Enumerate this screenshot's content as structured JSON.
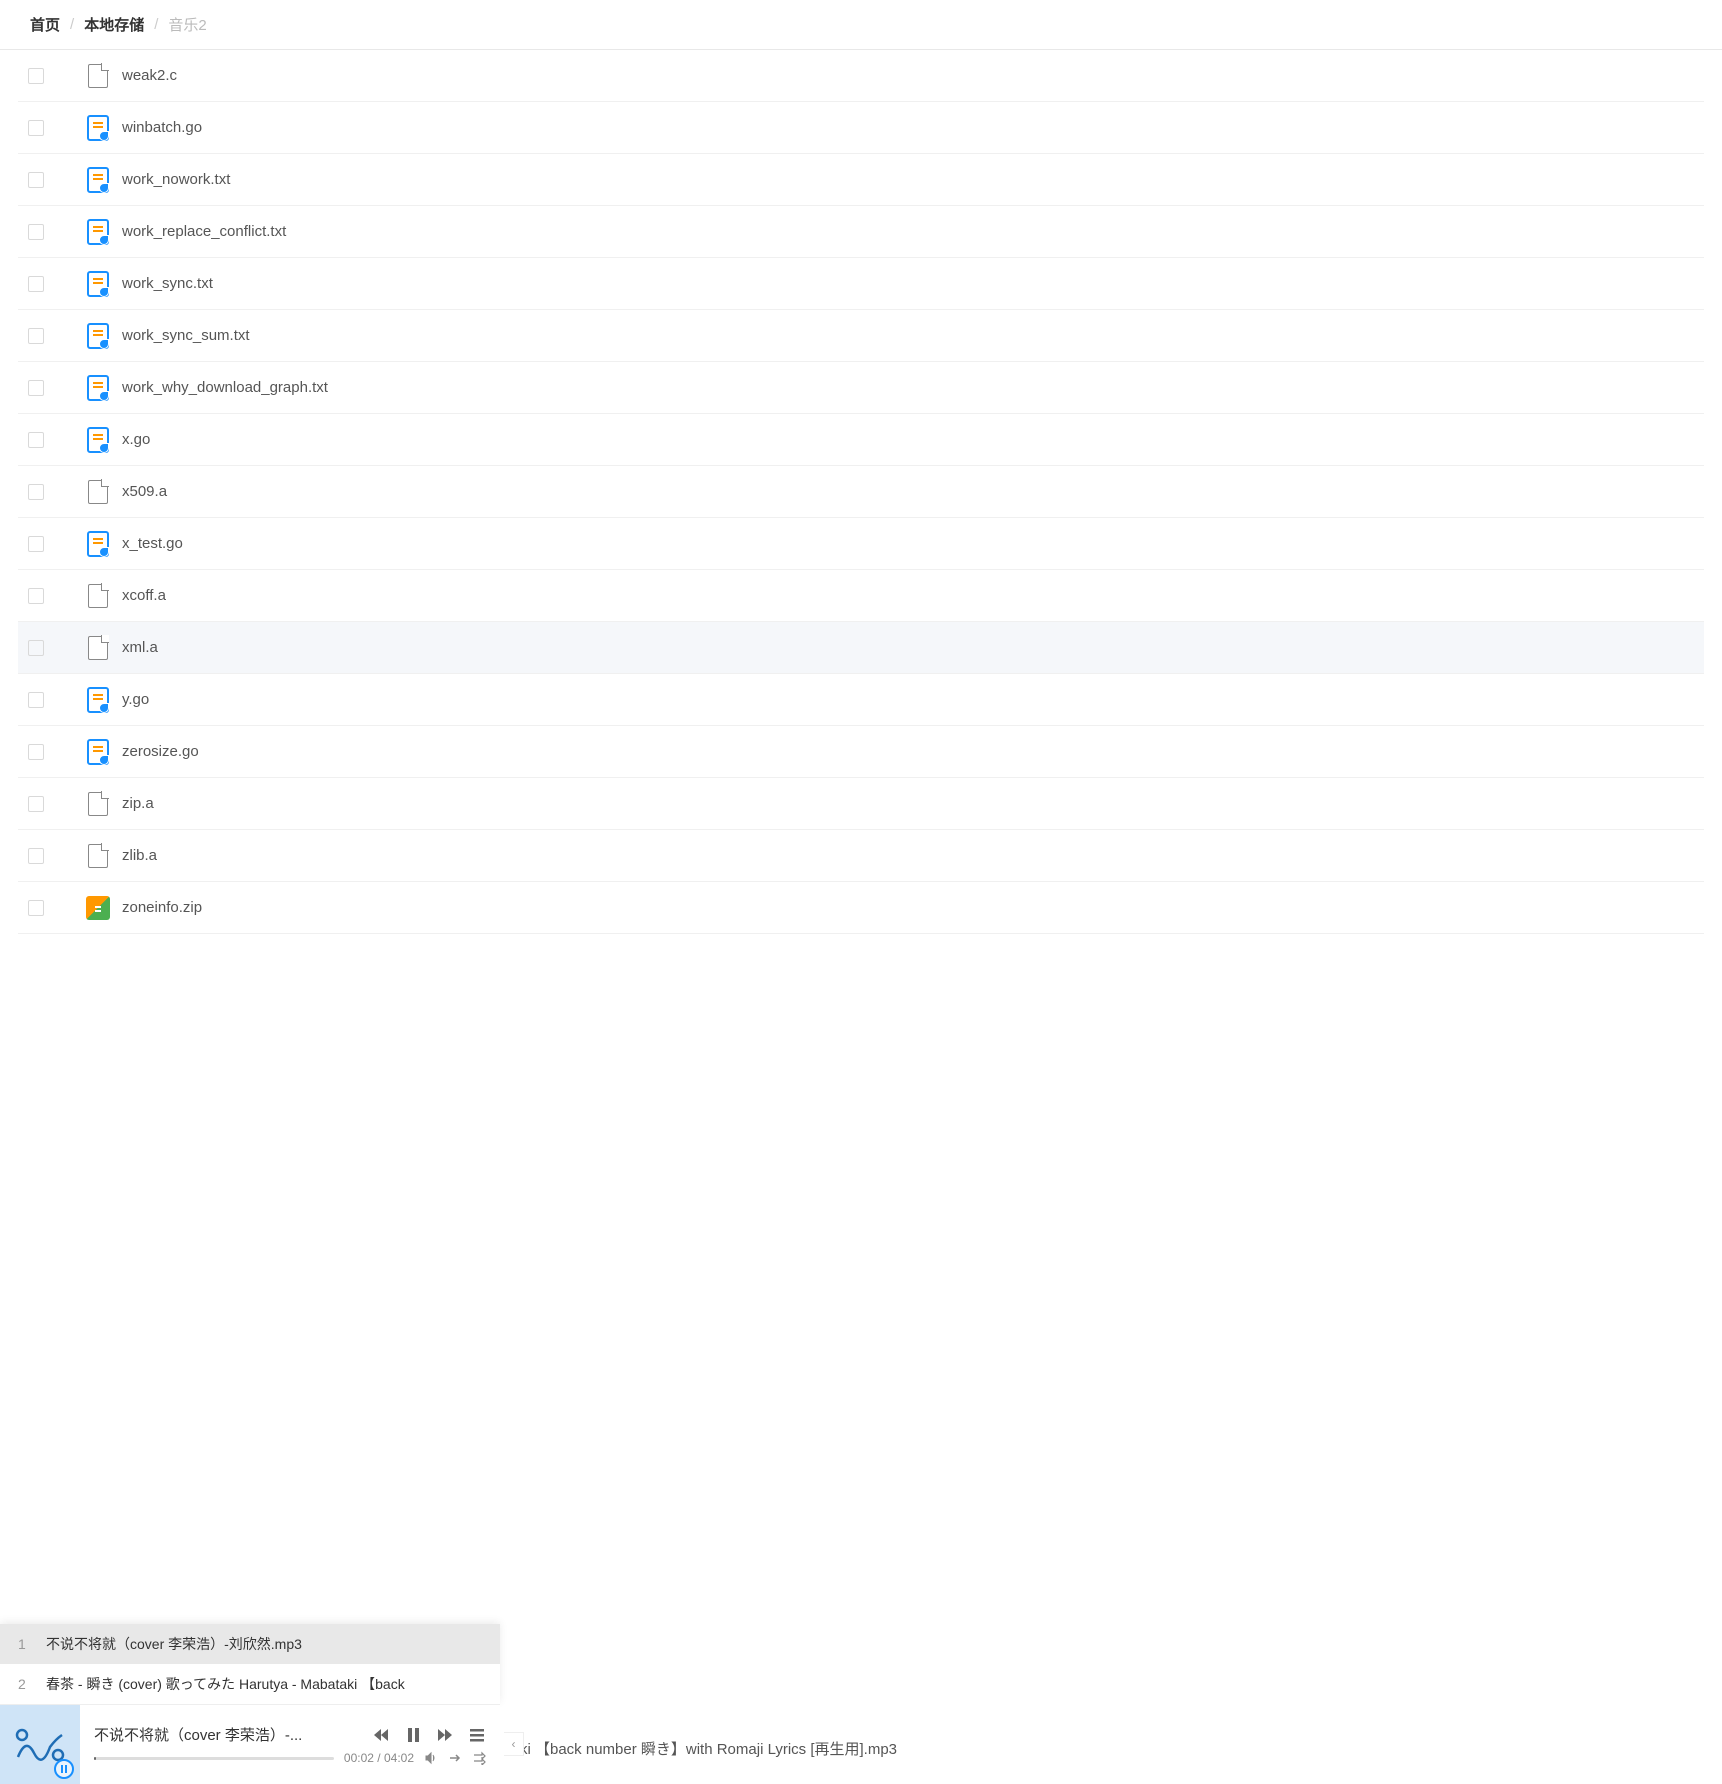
{
  "breadcrumb": {
    "home": "首页",
    "local": "本地存储",
    "current": "音乐2"
  },
  "files": [
    {
      "name": "weak2.c",
      "icon": "generic",
      "highlighted": false
    },
    {
      "name": "winbatch.go",
      "icon": "text",
      "highlighted": false
    },
    {
      "name": "work_nowork.txt",
      "icon": "text",
      "highlighted": false
    },
    {
      "name": "work_replace_conflict.txt",
      "icon": "text",
      "highlighted": false
    },
    {
      "name": "work_sync.txt",
      "icon": "text",
      "highlighted": false
    },
    {
      "name": "work_sync_sum.txt",
      "icon": "text",
      "highlighted": false
    },
    {
      "name": "work_why_download_graph.txt",
      "icon": "text",
      "highlighted": false
    },
    {
      "name": "x.go",
      "icon": "text",
      "highlighted": false
    },
    {
      "name": "x509.a",
      "icon": "generic",
      "highlighted": false
    },
    {
      "name": "x_test.go",
      "icon": "text",
      "highlighted": false
    },
    {
      "name": "xcoff.a",
      "icon": "generic",
      "highlighted": false
    },
    {
      "name": "xml.a",
      "icon": "generic",
      "highlighted": true
    },
    {
      "name": "y.go",
      "icon": "text",
      "highlighted": false
    },
    {
      "name": "zerosize.go",
      "icon": "text",
      "highlighted": false
    },
    {
      "name": "zip.a",
      "icon": "generic",
      "highlighted": false
    },
    {
      "name": "zlib.a",
      "icon": "generic",
      "highlighted": false
    },
    {
      "name": "zoneinfo.zip",
      "icon": "zip",
      "highlighted": false
    }
  ],
  "playlist": [
    {
      "num": "1",
      "title": "不说不将就（cover 李荣浩）-刘欣然.mp3",
      "active": true
    },
    {
      "num": "2",
      "title": "春茶 - 瞬き (cover) 歌ってみた Harutya - Mabataki 【back",
      "active": false
    }
  ],
  "player": {
    "title": "不说不将就（cover 李荣浩）-...",
    "current_time": "00:02",
    "duration": "04:02",
    "time_sep": " / "
  },
  "behind_text": "ki 【back number 瞬き】with Romaji Lyrics [再生用].mp3",
  "collapse_label": "‹"
}
